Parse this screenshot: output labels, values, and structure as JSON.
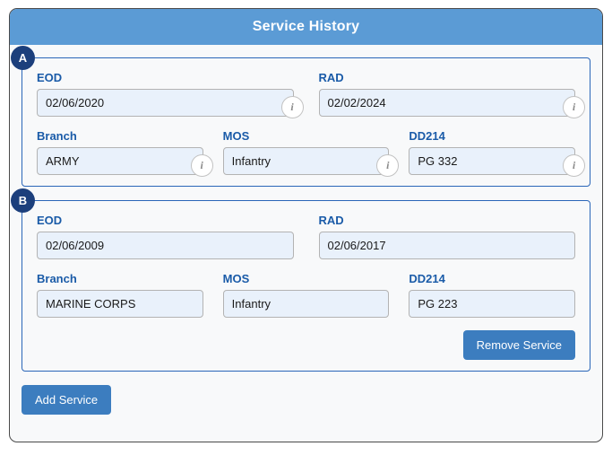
{
  "header": {
    "title": "Service History"
  },
  "services": [
    {
      "badge": "A",
      "fields": {
        "eod": {
          "label": "EOD",
          "value": "02/06/2020",
          "info": "i",
          "has_info": true
        },
        "rad": {
          "label": "RAD",
          "value": "02/02/2024",
          "info": "i",
          "has_info": true
        },
        "branch": {
          "label": "Branch",
          "value": "ARMY",
          "info": "i",
          "has_info": true
        },
        "mos": {
          "label": "MOS",
          "value": "Infantry",
          "info": "i",
          "has_info": true
        },
        "dd214": {
          "label": "DD214",
          "value": "PG 332",
          "info": "i",
          "has_info": true
        }
      },
      "remove_label": null
    },
    {
      "badge": "B",
      "fields": {
        "eod": {
          "label": "EOD",
          "value": "02/06/2009",
          "has_info": false
        },
        "rad": {
          "label": "RAD",
          "value": "02/06/2017",
          "has_info": false
        },
        "branch": {
          "label": "Branch",
          "value": "MARINE CORPS",
          "has_info": false
        },
        "mos": {
          "label": "MOS",
          "value": "Infantry",
          "has_info": false
        },
        "dd214": {
          "label": "DD214",
          "value": "PG 223",
          "has_info": false
        }
      },
      "remove_label": "Remove Service"
    }
  ],
  "footer": {
    "add_label": "Add Service"
  },
  "colors": {
    "header_blue": "#5b9bd5",
    "badge_navy": "#1c3f7c",
    "label_blue": "#1a5ba8",
    "panel_border": "#2a66b8",
    "button_blue": "#3c7dbf",
    "input_fill": "#e9f1fb"
  }
}
